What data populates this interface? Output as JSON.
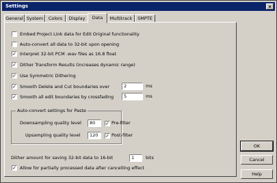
{
  "window": {
    "title": "Settings",
    "close_glyph": "×"
  },
  "tabs": [
    "General",
    "System",
    "Colors",
    "Display",
    "Data",
    "Multitrack",
    "SMPTE"
  ],
  "active_tab": "Data",
  "options": [
    {
      "label": "Embed Project Link data for Edit Original functionality",
      "checked": false
    },
    {
      "label": "Auto-convert all data to 32-bit upon opening",
      "checked": false
    },
    {
      "label": "Interpret 32-bit PCM .wav files as 16.8 float",
      "checked": true
    },
    {
      "label": "Dither Transform Results (increases dynamic range)",
      "checked": true
    },
    {
      "label": "Use Symmetric Dithering",
      "checked": true
    },
    {
      "label": "Smooth Delete and Cut boundaries over",
      "checked": true,
      "value": "2",
      "unit": "ms"
    },
    {
      "label": "Smooth all edit boundaries by crossfading",
      "checked": true,
      "value": "5",
      "unit": "ms"
    }
  ],
  "paste_group": {
    "title": "Auto-convert settings for Paste",
    "downsampling_label": "Downsampling quality level",
    "downsampling_value": "80",
    "upsampling_label": "Upsampling quality level",
    "upsampling_value": "120",
    "pre_filter_label": "Pre-filter",
    "pre_filter_checked": true,
    "post_filter_label": "Post-filter",
    "post_filter_checked": true
  },
  "dither_row": {
    "label": "Dither amount for saving 32-bit data to 16-bit",
    "value": "1",
    "unit": "bits"
  },
  "partial_option": {
    "label": "Allow for partially processed data after cancelling effect",
    "checked": true
  },
  "buttons": {
    "ok": "OK",
    "cancel": "Cancel",
    "help": "Help"
  },
  "check_glyph": "✓"
}
